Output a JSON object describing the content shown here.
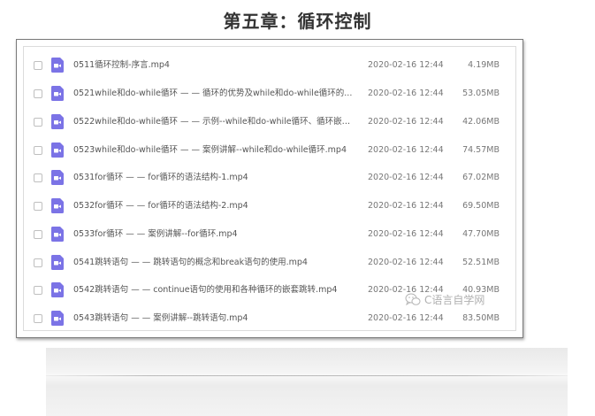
{
  "chapter": {
    "title": "第五章：循环控制"
  },
  "files": [
    {
      "name": "0511循环控制-序言.mp4",
      "date": "2020-02-16 12:44",
      "size": "4.19MB"
    },
    {
      "name": "0521while和do-while循环 — — 循环的优势及while和do-while循环的...",
      "date": "2020-02-16 12:44",
      "size": "53.05MB"
    },
    {
      "name": "0522while和do-while循环 — — 示例--while和do-while循环、循环嵌套...",
      "date": "2020-02-16 12:44",
      "size": "42.06MB"
    },
    {
      "name": "0523while和do-while循环 — — 案例讲解--while和do-while循环.mp4",
      "date": "2020-02-16 12:44",
      "size": "74.57MB"
    },
    {
      "name": "0531for循环 — — for循环的语法结构-1.mp4",
      "date": "2020-02-16 12:44",
      "size": "67.02MB"
    },
    {
      "name": "0532for循环 — — for循环的语法结构-2.mp4",
      "date": "2020-02-16 12:44",
      "size": "69.50MB"
    },
    {
      "name": "0533for循环 — — 案例讲解--for循环.mp4",
      "date": "2020-02-16 12:44",
      "size": "47.70MB"
    },
    {
      "name": "0541跳转语句 — — 跳转语句的概念和break语句的使用.mp4",
      "date": "2020-02-16 12:44",
      "size": "52.51MB"
    },
    {
      "name": "0542跳转语句 — — continue语句的使用和各种循环的嵌套跳转.mp4",
      "date": "2020-02-16 12:44",
      "size": "40.93MB"
    },
    {
      "name": "0543跳转语句 — — 案例讲解--跳转语句.mp4",
      "date": "2020-02-16 12:44",
      "size": "83.50MB"
    }
  ],
  "watermark": {
    "text": "C语言自学网",
    "icon": "wechat-icon"
  },
  "colors": {
    "video_icon": "#7b73e6",
    "text": "#555555",
    "meta_text": "#777777"
  }
}
